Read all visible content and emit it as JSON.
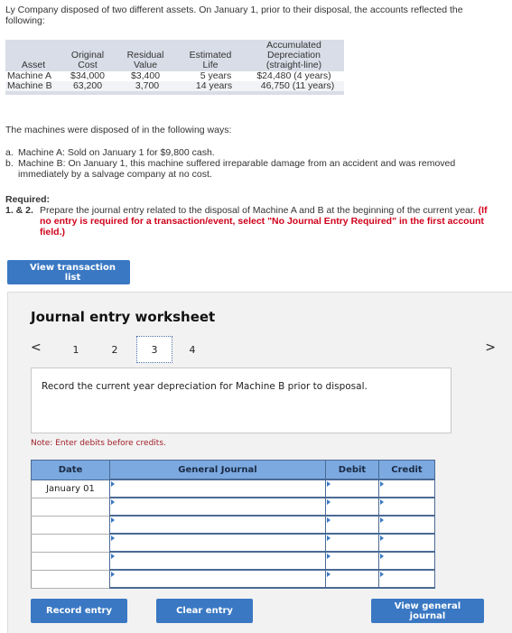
{
  "intro": "Ly Company disposed of two different assets. On January 1, prior to their disposal, the accounts reflected the following:",
  "asset_table": {
    "headers": {
      "asset": "Asset",
      "original_cost_1": "Original",
      "original_cost_2": "Cost",
      "residual_1": "Residual",
      "residual_2": "Value",
      "life_1": "Estimated",
      "life_2": "Life",
      "accum_1": "Accumulated",
      "accum_2": "Depreciation",
      "accum_3": "(straight-line)"
    },
    "rows": [
      {
        "asset": "Machine A",
        "cost": "$34,000",
        "residual": "$3,400",
        "life": "5 years",
        "accum": "$24,480 (4 years)"
      },
      {
        "asset": "Machine B",
        "cost": "63,200",
        "residual": "3,700",
        "life": "14 years",
        "accum": "46,750 (11 years)"
      }
    ]
  },
  "disposal_intro": "The machines were disposed of in the following ways:",
  "disposals": [
    {
      "label": "a.",
      "text": "Machine A: Sold on January 1 for $9,800 cash."
    },
    {
      "label": "b.",
      "text": "Machine B: On January 1, this machine suffered irreparable damage from an accident and was removed immediately by a salvage company at no cost."
    }
  ],
  "required": {
    "title": "Required:",
    "number": "1. & 2.",
    "text": "Prepare the journal entry related to the disposal of Machine A and B at the beginning of the current year.",
    "red_text": "(If no entry is required for a transaction/event, select \"No Journal Entry Required\" in the first account field.)"
  },
  "buttons": {
    "view_transaction_list": "View transaction list",
    "record_entry": "Record entry",
    "clear_entry": "Clear entry",
    "view_general_journal": "View general journal"
  },
  "worksheet": {
    "title": "Journal entry worksheet",
    "prev_arrow": "<",
    "next_arrow": ">",
    "pages": [
      "1",
      "2",
      "3",
      "4"
    ],
    "active_page": "3",
    "instruction": "Record the current year depreciation for Machine B prior to disposal.",
    "note": "Note: Enter debits before credits.",
    "table": {
      "headers": {
        "date": "Date",
        "general_journal": "General Journal",
        "debit": "Debit",
        "credit": "Credit"
      },
      "rows": [
        {
          "date": "January 01",
          "account": "",
          "debit": "",
          "credit": ""
        },
        {
          "date": "",
          "account": "",
          "debit": "",
          "credit": ""
        },
        {
          "date": "",
          "account": "",
          "debit": "",
          "credit": ""
        },
        {
          "date": "",
          "account": "",
          "debit": "",
          "credit": ""
        },
        {
          "date": "",
          "account": "",
          "debit": "",
          "credit": ""
        },
        {
          "date": "",
          "account": "",
          "debit": "",
          "credit": ""
        }
      ]
    }
  },
  "colors": {
    "button_blue": "#3a78c3",
    "header_blue": "#7ba9e0",
    "required_red": "#d0021b",
    "note_red": "#a0202a"
  }
}
